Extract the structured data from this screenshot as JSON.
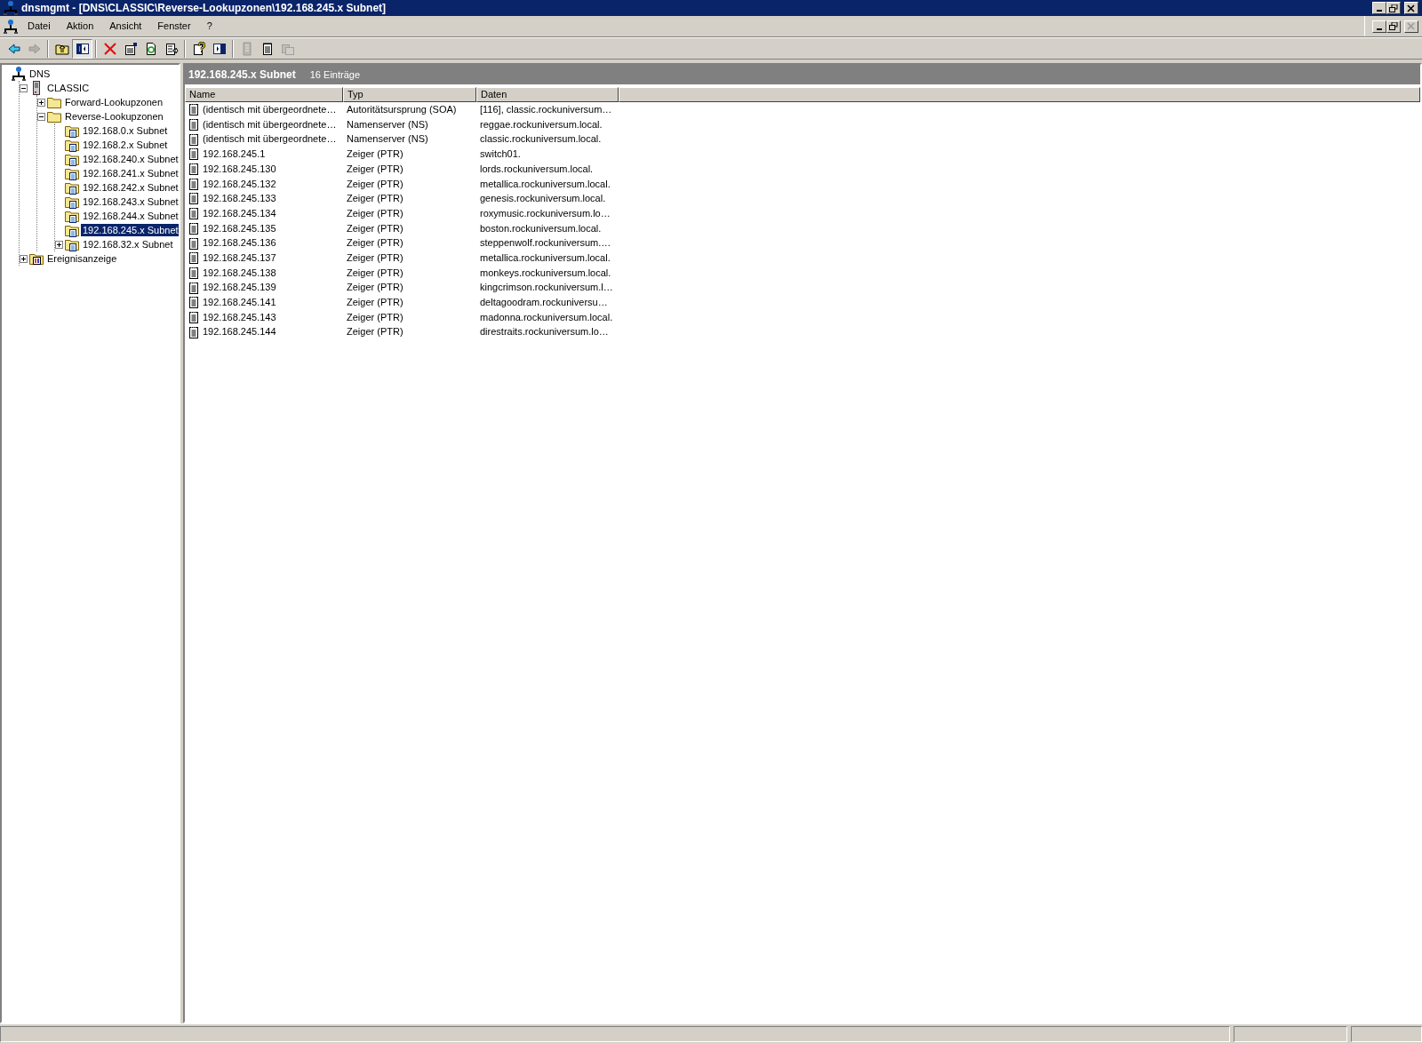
{
  "window": {
    "title": "dnsmgmt - [DNS\\CLASSIC\\Reverse-Lookupzonen\\192.168.245.x Subnet]"
  },
  "menu": [
    {
      "label": "Datei"
    },
    {
      "label": "Aktion"
    },
    {
      "label": "Ansicht"
    },
    {
      "label": "Fenster"
    },
    {
      "label": "?"
    }
  ],
  "toolbar": [
    {
      "kind": "back",
      "disabled": false,
      "pressed": false
    },
    {
      "kind": "forward",
      "disabled": true,
      "pressed": false
    },
    {
      "kind": "sep"
    },
    {
      "kind": "up",
      "disabled": false,
      "pressed": false
    },
    {
      "kind": "tree",
      "disabled": false,
      "pressed": true
    },
    {
      "kind": "sep"
    },
    {
      "kind": "delete",
      "disabled": false,
      "pressed": false
    },
    {
      "kind": "properties",
      "disabled": false,
      "pressed": false
    },
    {
      "kind": "refresh",
      "disabled": false,
      "pressed": false
    },
    {
      "kind": "export",
      "disabled": false,
      "pressed": false
    },
    {
      "kind": "sep"
    },
    {
      "kind": "help",
      "disabled": false,
      "pressed": false
    },
    {
      "kind": "pane",
      "disabled": false,
      "pressed": false
    },
    {
      "kind": "sep"
    },
    {
      "kind": "record",
      "disabled": true,
      "pressed": false
    },
    {
      "kind": "notes",
      "disabled": false,
      "pressed": false
    },
    {
      "kind": "copy",
      "disabled": true,
      "pressed": false
    }
  ],
  "tree": [
    {
      "label": "DNS",
      "kind": "dns",
      "selected": false,
      "children": [
        {
          "label": "CLASSIC",
          "kind": "server",
          "selected": false,
          "expanded": true,
          "children": [
            {
              "label": "Forward-Lookupzonen",
              "kind": "folder",
              "selected": false,
              "expanded": false
            },
            {
              "label": "Reverse-Lookupzonen",
              "kind": "folder",
              "selected": false,
              "expanded": true,
              "children": [
                {
                  "label": "192.168.0.x Subnet",
                  "kind": "zone",
                  "selected": false
                },
                {
                  "label": "192.168.2.x Subnet",
                  "kind": "zone",
                  "selected": false
                },
                {
                  "label": "192.168.240.x Subnet",
                  "kind": "zone",
                  "selected": false
                },
                {
                  "label": "192.168.241.x Subnet",
                  "kind": "zone",
                  "selected": false
                },
                {
                  "label": "192.168.242.x Subnet",
                  "kind": "zone",
                  "selected": false
                },
                {
                  "label": "192.168.243.x Subnet",
                  "kind": "zone",
                  "selected": false
                },
                {
                  "label": "192.168.244.x Subnet",
                  "kind": "zone",
                  "selected": false
                },
                {
                  "label": "192.168.245.x Subnet",
                  "kind": "zone",
                  "selected": true
                },
                {
                  "label": "192.168.32.x Subnet",
                  "kind": "zone",
                  "selected": false,
                  "expanded": false
                }
              ]
            }
          ]
        },
        {
          "label": "Ereignisanzeige",
          "kind": "events",
          "selected": false,
          "expanded": false
        }
      ]
    }
  ],
  "pane_header": {
    "title": "192.168.245.x Subnet",
    "count": "16 Einträge"
  },
  "table": {
    "columns": [
      "Name",
      "Typ",
      "Daten"
    ],
    "rows": [
      [
        "(identisch mit übergeordnete…",
        "Autoritätsursprung (SOA)",
        "[116], classic.rockuniversum…"
      ],
      [
        "(identisch mit übergeordnete…",
        "Namenserver (NS)",
        "reggae.rockuniversum.local."
      ],
      [
        "(identisch mit übergeordnete…",
        "Namenserver (NS)",
        "classic.rockuniversum.local."
      ],
      [
        "192.168.245.1",
        "Zeiger (PTR)",
        "switch01."
      ],
      [
        "192.168.245.130",
        "Zeiger (PTR)",
        "lords.rockuniversum.local."
      ],
      [
        "192.168.245.132",
        "Zeiger (PTR)",
        "metallica.rockuniversum.local."
      ],
      [
        "192.168.245.133",
        "Zeiger (PTR)",
        "genesis.rockuniversum.local."
      ],
      [
        "192.168.245.134",
        "Zeiger (PTR)",
        "roxymusic.rockuniversum.lo…"
      ],
      [
        "192.168.245.135",
        "Zeiger (PTR)",
        "boston.rockuniversum.local."
      ],
      [
        "192.168.245.136",
        "Zeiger (PTR)",
        "steppenwolf.rockuniversum.…"
      ],
      [
        "192.168.245.137",
        "Zeiger (PTR)",
        "metallica.rockuniversum.local."
      ],
      [
        "192.168.245.138",
        "Zeiger (PTR)",
        "monkeys.rockuniversum.local."
      ],
      [
        "192.168.245.139",
        "Zeiger (PTR)",
        "kingcrimson.rockuniversum.l…"
      ],
      [
        "192.168.245.141",
        "Zeiger (PTR)",
        "deltagoodram.rockuniversu…"
      ],
      [
        "192.168.245.143",
        "Zeiger (PTR)",
        "madonna.rockuniversum.local."
      ],
      [
        "192.168.245.144",
        "Zeiger (PTR)",
        "direstraits.rockuniversum.lo…"
      ]
    ]
  }
}
